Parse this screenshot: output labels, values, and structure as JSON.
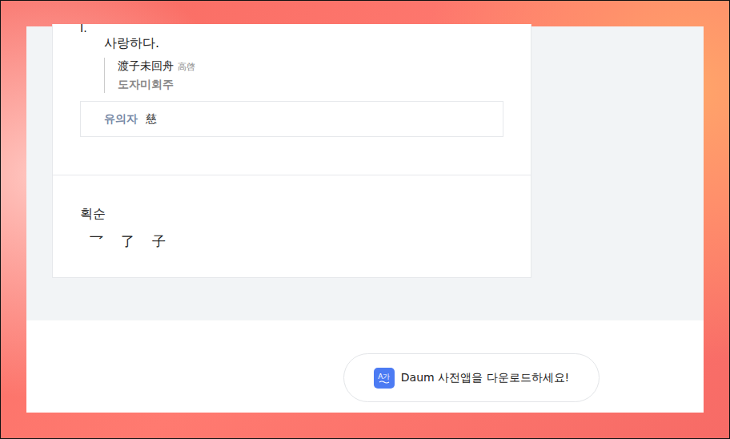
{
  "definition": {
    "number": "I.",
    "meaning": "사랑하다."
  },
  "example": {
    "hanja": "渡子未回舟",
    "author": "高啓",
    "reading": "도자미회주"
  },
  "synonym": {
    "label": "유의자",
    "value": "慈"
  },
  "stroke_order": {
    "title": "획순",
    "strokes": [
      "乛",
      "了",
      "子"
    ]
  },
  "app_banner": {
    "icon_text": "A가",
    "text": "Daum 사전앱을 다운로드하세요!"
  }
}
